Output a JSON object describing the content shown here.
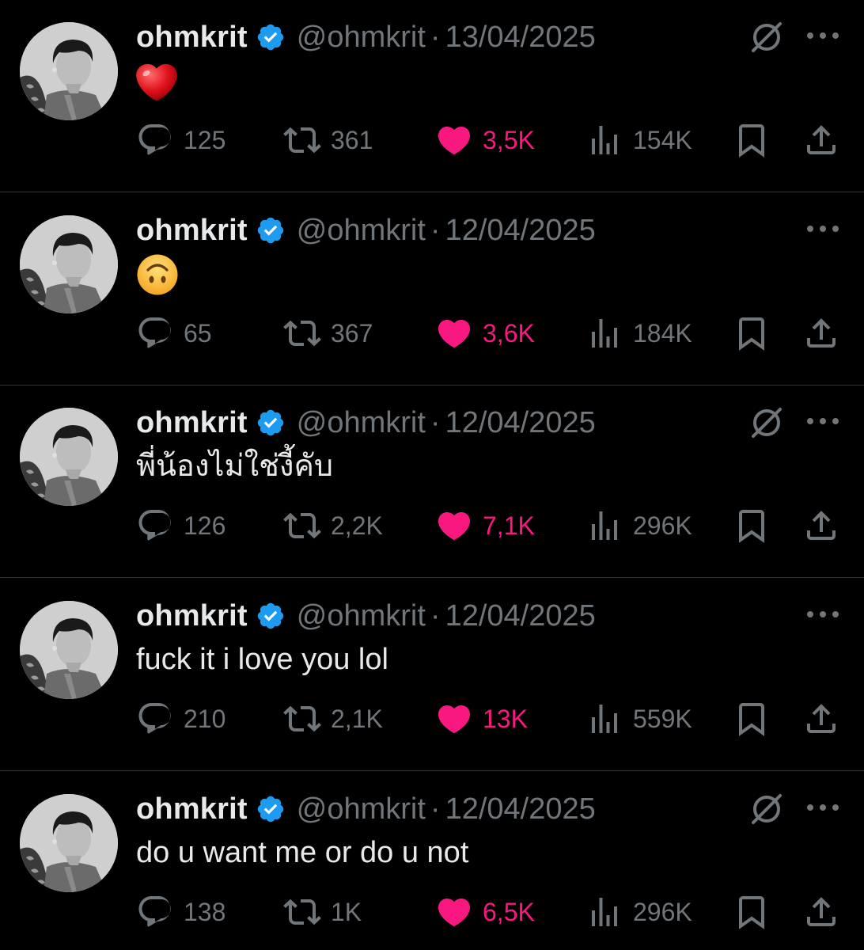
{
  "colors": {
    "background": "#000000",
    "text": "#e7e9ea",
    "muted": "#71767b",
    "like": "#f91880",
    "verified": "#1d9bf0",
    "divider": "#2f3336"
  },
  "tweets": [
    {
      "name": "ohmkrit",
      "handle": "@ohmkrit",
      "separator": "·",
      "date": "13/04/2025",
      "content": "",
      "content_emoji": "red-heart",
      "has_grok": true,
      "replies": "125",
      "retweets": "361",
      "likes": "3,5K",
      "views": "154K"
    },
    {
      "name": "ohmkrit",
      "handle": "@ohmkrit",
      "separator": "·",
      "date": "12/04/2025",
      "content": "",
      "content_emoji": "upside-down-face",
      "has_grok": false,
      "replies": "65",
      "retweets": "367",
      "likes": "3,6K",
      "views": "184K"
    },
    {
      "name": "ohmkrit",
      "handle": "@ohmkrit",
      "separator": "·",
      "date": "12/04/2025",
      "content": "พี่น้องไม่ใช่งี้คับ",
      "content_emoji": "",
      "has_grok": true,
      "replies": "126",
      "retweets": "2,2K",
      "likes": "7,1K",
      "views": "296K"
    },
    {
      "name": "ohmkrit",
      "handle": "@ohmkrit",
      "separator": "·",
      "date": "12/04/2025",
      "content": "fuck it i love you lol",
      "content_emoji": "",
      "has_grok": false,
      "replies": "210",
      "retweets": "2,1K",
      "likes": "13K",
      "views": "559K"
    },
    {
      "name": "ohmkrit",
      "handle": "@ohmkrit",
      "separator": "·",
      "date": "12/04/2025",
      "content": "do u want me or do u not",
      "content_emoji": "",
      "has_grok": true,
      "replies": "138",
      "retweets": "1K",
      "likes": "6,5K",
      "views": "296K"
    }
  ]
}
